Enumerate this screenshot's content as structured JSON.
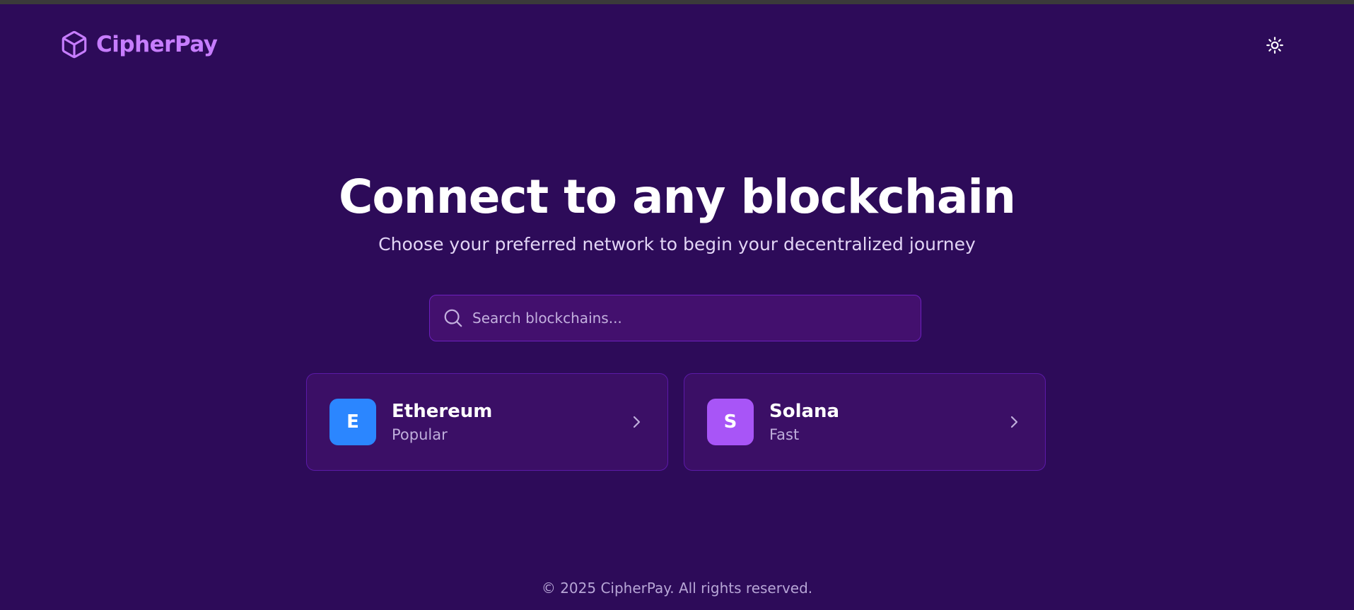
{
  "brand": {
    "name": "CipherPay",
    "logo_icon": "cube-icon",
    "accent_color": "#c77dff"
  },
  "header": {
    "theme_toggle_icon": "sun-icon"
  },
  "hero": {
    "title": "Connect to any blockchain",
    "subtitle": "Choose your preferred network to begin your decentralized journey"
  },
  "search": {
    "placeholder": "Search blockchains...",
    "value": "",
    "icon": "search-icon"
  },
  "chains": [
    {
      "initial": "E",
      "name": "Ethereum",
      "tag": "Popular",
      "color": "#2b86ff",
      "icon": "chevron-right-icon"
    },
    {
      "initial": "S",
      "name": "Solana",
      "tag": "Fast",
      "color": "#a855f7",
      "icon": "chevron-right-icon"
    }
  ],
  "footer": {
    "text": "© 2025 CipherPay. All rights reserved."
  },
  "colors": {
    "background": "#2d0b59",
    "card": "#3b0f66",
    "search_bg": "#43106e"
  }
}
